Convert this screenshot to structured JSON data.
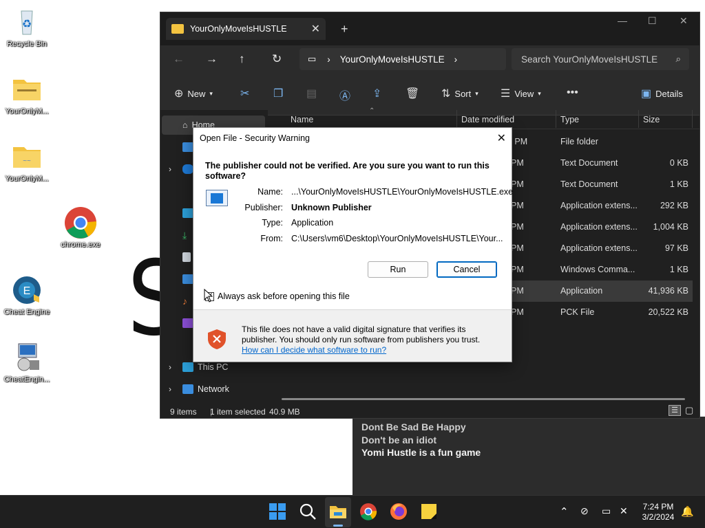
{
  "desktop": {
    "icons": [
      {
        "label": "Recycle Bin",
        "icon": "recycle-bin-icon"
      },
      {
        "label": "YourOnlyM...",
        "icon": "zip-folder-icon"
      },
      {
        "label": "YourOnlyM...",
        "icon": "folder-icon"
      },
      {
        "label": "chrome.exe",
        "icon": "chrome-icon"
      },
      {
        "label": "Cheat Engine",
        "icon": "cheat-engine-icon"
      },
      {
        "label": "CheatEngin...",
        "icon": "installer-icon"
      }
    ],
    "scribble": "S"
  },
  "sticky_note": {
    "lines": [
      "Dont Be Sad Be Happy",
      "Don't be an idiot",
      "Yomi Hustle is a fun game"
    ]
  },
  "explorer": {
    "tab_title": "YourOnlyMoveIsHUSTLE",
    "address": "YourOnlyMoveIsHUSTLE",
    "search_placeholder": "Search YourOnlyMoveIsHUSTLE",
    "toolbar": {
      "new": "New",
      "sort": "Sort",
      "view": "View",
      "details": "Details"
    },
    "nav": {
      "home": "Home",
      "this_pc": "This PC",
      "network": "Network"
    },
    "columns": {
      "name": "Name",
      "date": "Date modified",
      "type": "Type",
      "size": "Size"
    },
    "rows": [
      {
        "date": "23 PM",
        "type": "File folder",
        "size": ""
      },
      {
        "date": "PM",
        "type": "Text Document",
        "size": "0 KB"
      },
      {
        "date": "PM",
        "type": "Text Document",
        "size": "1 KB"
      },
      {
        "date": "PM",
        "type": "Application extens...",
        "size": "292 KB"
      },
      {
        "date": "PM",
        "type": "Application extens...",
        "size": "1,004 KB"
      },
      {
        "date": "PM",
        "type": "Application extens...",
        "size": "97 KB"
      },
      {
        "date": "PM",
        "type": "Windows Comma...",
        "size": "1 KB"
      },
      {
        "date": "PM",
        "type": "Application",
        "size": "41,936 KB"
      },
      {
        "date": "PM",
        "type": "PCK File",
        "size": "20,522 KB"
      }
    ],
    "status": {
      "items": "9 items",
      "selected": "1 item selected",
      "size": "40.9 MB"
    }
  },
  "dialog": {
    "title": "Open File - Security Warning",
    "question": "The publisher could not be verified.  Are you sure you want to run this software?",
    "fields": {
      "name_label": "Name:",
      "name_value": "...\\YourOnlyMoveIsHUSTLE\\YourOnlyMoveIsHUSTLE.exe",
      "publisher_label": "Publisher:",
      "publisher_value": "Unknown Publisher",
      "type_label": "Type:",
      "type_value": "Application",
      "from_label": "From:",
      "from_value": "C:\\Users\\vm6\\Desktop\\YourOnlyMoveIsHUSTLE\\Your..."
    },
    "run_label": "Run",
    "cancel_label": "Cancel",
    "checkbox_label": "Always ask before opening this file",
    "warning_text": "This file does not have a valid digital signature that verifies its publisher.  You should only run software from publishers you trust.",
    "link_text": "How can I decide what software to run?"
  },
  "taskbar": {
    "time": "7:24 PM",
    "date": "3/2/2024"
  }
}
